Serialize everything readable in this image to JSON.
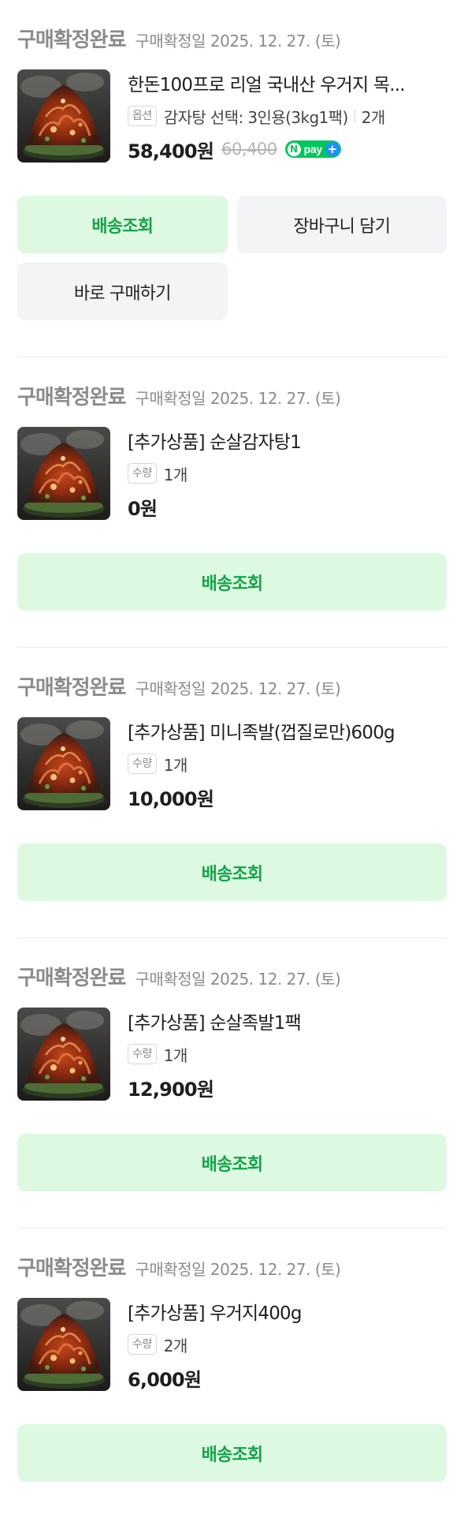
{
  "orders": [
    {
      "status": "구매확정완료",
      "confirm_date": "구매확정일 2025. 12. 27. (토)",
      "product_name": "한돈100프로 리얼 국내산 우거지 목...",
      "tag": "옵션",
      "meta_text": "감자탕 선택: 3인용(3kg1팩)",
      "qty": "2개",
      "price": "58,400원",
      "original_price": "60,400",
      "npay": {
        "n": "N",
        "text": "pay",
        "plus": "+"
      },
      "buttons": [
        "배송조회",
        "장바구니 담기",
        "바로 구매하기"
      ]
    },
    {
      "status": "구매확정완료",
      "confirm_date": "구매확정일 2025. 12. 27. (토)",
      "product_name": "[추가상품] 순살감자탕1",
      "tag": "수량",
      "qty": "1개",
      "price": "0원",
      "buttons": [
        "배송조회"
      ]
    },
    {
      "status": "구매확정완료",
      "confirm_date": "구매확정일 2025. 12. 27. (토)",
      "product_name": "[추가상품] 미니족발(껍질로만)600g",
      "tag": "수량",
      "qty": "1개",
      "price": "10,000원",
      "buttons": [
        "배송조회"
      ]
    },
    {
      "status": "구매확정완료",
      "confirm_date": "구매확정일 2025. 12. 27. (토)",
      "product_name": "[추가상품] 순살족발1팩",
      "tag": "수량",
      "qty": "1개",
      "price": "12,900원",
      "buttons": [
        "배송조회"
      ]
    },
    {
      "status": "구매확정완료",
      "confirm_date": "구매확정일 2025. 12. 27. (토)",
      "product_name": "[추가상품] 우거지400g",
      "tag": "수량",
      "qty": "2개",
      "price": "6,000원",
      "buttons": [
        "배송조회"
      ]
    }
  ],
  "colors": {
    "status_gray": "#8b8b8b",
    "button_green_bg": "#ddf9e2",
    "button_green_text": "#16a34a",
    "button_gray_bg": "#f3f4f6",
    "npay_green": "#03c75a",
    "npay_plus_blue": "#1f8fff"
  },
  "icons": {
    "thumbnail": "food-thumbnail-image",
    "npay": "npay-badge"
  }
}
